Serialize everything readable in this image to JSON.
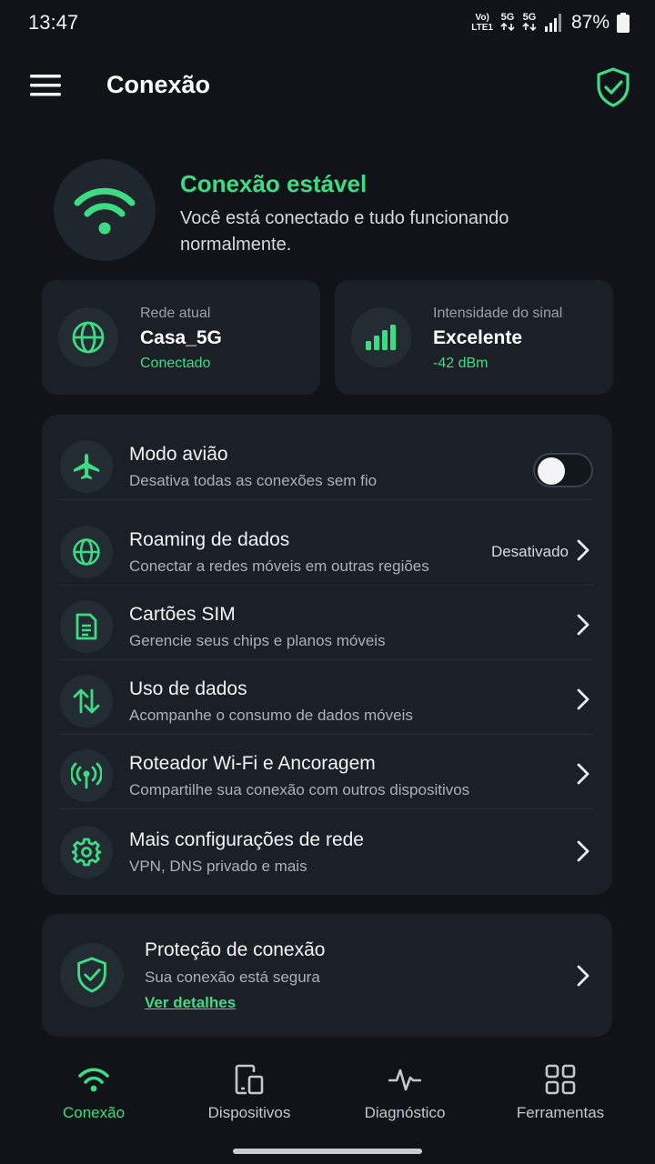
{
  "status_bar": {
    "time": "13:47",
    "volte_top": "Vo)",
    "volte_bottom": "LTE1",
    "net1": "5G",
    "net2": "5G",
    "battery": "87%"
  },
  "app_bar": {
    "title": "Conexão",
    "menu_icon": "hamburger-menu-icon",
    "action_icon": "shield-check-icon"
  },
  "hero": {
    "icon": "wifi-icon",
    "title": "Conexão estável",
    "description": "Você está conectado e tudo funcionando normalmente."
  },
  "info_cards": [
    {
      "icon": "globe-icon",
      "label": "Rede atual",
      "value": "Casa_5G",
      "sub": "Conectado"
    },
    {
      "icon": "signal-bars-icon",
      "label": "Intensidade do sinal",
      "value": "Excelente",
      "sub": "-42 dBm"
    }
  ],
  "settings": [
    {
      "icon": "airplane-icon",
      "title": "Modo avião",
      "subtitle": "Desativa todas as conexões sem fio",
      "toggle_on": false
    },
    {
      "icon": "globe-icon",
      "title": "Roaming de dados",
      "subtitle": "Conectar a redes móveis em outras regiões",
      "value": "Desativado"
    },
    {
      "icon": "sim-card-icon",
      "title": "Cartões SIM",
      "subtitle": "Gerencie seus chips e planos móveis"
    },
    {
      "icon": "data-transfer-icon",
      "title": "Uso de dados",
      "subtitle": "Acompanhe o consumo de dados móveis"
    },
    {
      "icon": "hotspot-icon",
      "title": "Roteador Wi-Fi e Ancoragem",
      "subtitle": "Compartilhe sua conexão com outros dispositivos"
    },
    {
      "icon": "gear-icon",
      "title": "Mais configurações de rede",
      "subtitle": "VPN, DNS privado e mais"
    }
  ],
  "protection": {
    "icon": "shield-check-icon",
    "title": "Proteção de conexão",
    "subtitle": "Sua conexão está segura",
    "link": "Ver detalhes"
  },
  "bottom_nav": [
    {
      "icon": "wifi-icon",
      "label": "Conexão",
      "active": true
    },
    {
      "icon": "devices-icon",
      "label": "Dispositivos",
      "active": false
    },
    {
      "icon": "pulse-icon",
      "label": "Diagnóstico",
      "active": false
    },
    {
      "icon": "grid-icon",
      "label": "Ferramentas",
      "active": false
    }
  ],
  "colors": {
    "accent": "#3ddc84",
    "background": "#101419",
    "card": "#1a2026",
    "icon_circle": "#242c33"
  }
}
